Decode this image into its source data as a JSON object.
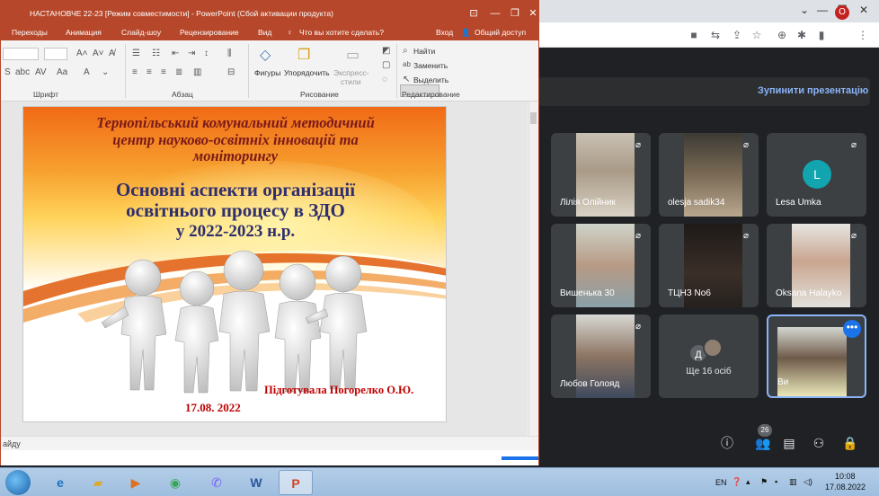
{
  "powerpoint": {
    "title": "НАСТАНОВЧЕ 22-23 [Режим совместимости] - PowerPoint (Сбой активации продукта)",
    "tabs": [
      "Переходы",
      "Анимация",
      "Слайд-шоу",
      "Рецензирование",
      "Вид"
    ],
    "tell_me": "Что вы хотите сделать?",
    "sign_in": "Вход",
    "share": "Общий доступ",
    "ribbon": {
      "font_group": "Шрифт",
      "paragraph_group": "Абзац",
      "drawing_group": "Рисование",
      "editing_group": "Редактирование",
      "shapes": "Фигуры",
      "arrange": "Упорядочить",
      "quick_styles_1": "Экспресс-",
      "quick_styles_2": "стили",
      "find": "Найти",
      "replace": "Заменить",
      "select": "Выделить"
    },
    "status": "айду"
  },
  "slide": {
    "line1": "Тернопільський комунальний  методичний",
    "line2": "центр науково-освітніх   інновацій та",
    "line3": "моніторингу",
    "line4": "Основні аспекти організації",
    "line5": "освітнього процесу в ЗДО",
    "line6": "у  2022-2023 н.р.",
    "author": "Підготувала  Погорелко О.Ю.",
    "date": "17.08. 2022"
  },
  "meet": {
    "stop_presenting": "Зупинити презентацію",
    "tiles": [
      {
        "name": "Лілія Олійник"
      },
      {
        "name": "olesja sadik34"
      },
      {
        "name": "Lesa Umka",
        "initial": "L"
      },
      {
        "name": "Вишенька 30"
      },
      {
        "name": "ТЦНЗ No6"
      },
      {
        "name": "Oksana Halayko"
      },
      {
        "name": "Любов Голояд"
      },
      {
        "name": "Ще 16 осіб",
        "initial": "Д"
      },
      {
        "name": "Ви"
      }
    ],
    "participant_count": "26"
  },
  "chrome": {
    "profile_initial": "O"
  },
  "taskbar": {
    "lang": "EN",
    "time": "10:08",
    "date": "17.08.2022"
  }
}
